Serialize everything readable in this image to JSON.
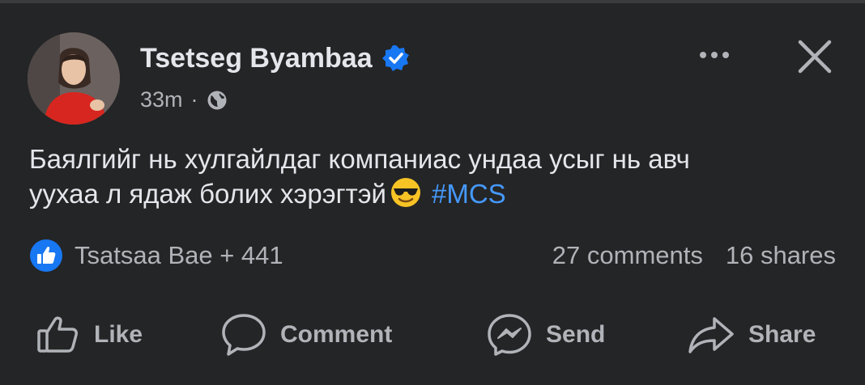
{
  "post": {
    "author": "Tsetseg Byambaa",
    "time": "33m",
    "separator": "·",
    "text_line1": "Баялгийг нь хулгайлдаг компаниас ундаа усыг нь авч",
    "text_line2": "уухаа л ядаж болих хэрэгтэй",
    "hashtag": "#MCS"
  },
  "icons": {
    "verified": "verified-badge-icon",
    "privacy": "globe-icon",
    "more": "more-options-icon",
    "close": "close-icon",
    "emoji": "sunglasses-emoji-icon",
    "reaction": "like-reaction-icon"
  },
  "reactions": {
    "text": "Tsatsaa Bae + 441"
  },
  "stats": {
    "comments": "27 comments",
    "shares": "16 shares"
  },
  "actions": {
    "like": "Like",
    "comment": "Comment",
    "send": "Send",
    "share": "Share"
  },
  "colors": {
    "background": "#242526",
    "primary_text": "#e4e6eb",
    "secondary_text": "#b0b3b8",
    "hashtag": "#4599ff",
    "verified_blue": "#1877f2"
  }
}
